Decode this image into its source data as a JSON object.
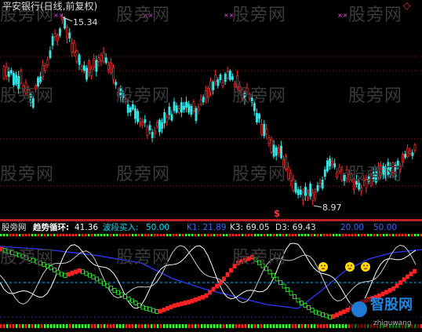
{
  "title": "平安银行(日线,前复权)",
  "price_high_label": "15.34",
  "price_low_label": "8.97",
  "signal_marker": "$",
  "corner_marker": "◇",
  "watermark": "股旁网",
  "indicator_bar": {
    "name": "股旁网",
    "trend_label": "趋势循环:",
    "trend_value": "41.36",
    "wave_label": "波段买入:",
    "wave_value": "50.00",
    "k1": "K1: 21.89",
    "k3": "K3: 69.05",
    "d3": "D3: 69.43",
    "right1": "20.00",
    "right2": "50.00"
  },
  "logo": {
    "name": "智股网",
    "url": "zhiguwang"
  },
  "colors": {
    "bg": "#000000",
    "up": "#ff3333",
    "down": "#33e5e5",
    "title": "#dddddd",
    "trend_label": "#ffffff",
    "wave_label": "#00e5ff",
    "k": "#e0e0e0",
    "hdr_blue": "#3a6aff",
    "sep": "#bb2222",
    "blue_line": "#2a3cff",
    "cyan_dash": "#00bbff",
    "magenta": "#ff44ff",
    "green": "#33ff33",
    "red": "#ff2222",
    "yellow": "#ffdd00"
  }
}
